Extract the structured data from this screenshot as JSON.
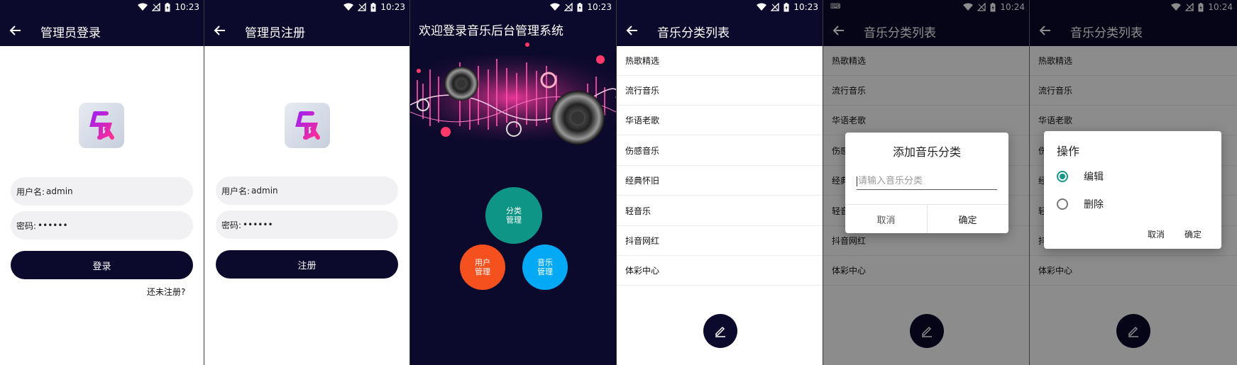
{
  "status": {
    "time_1": "10:23",
    "time_2": "10:23",
    "time_3": "10:23",
    "time_4": "10:23",
    "time_5": "10:24",
    "time_6": "10:24",
    "battery_icon": "battery-charging-icon",
    "wifi_icon": "wifi-icon",
    "signal_icon": "no-signal-icon"
  },
  "login": {
    "title": "管理员登录",
    "username_label": "用户名:",
    "username_value": "admin",
    "password_label": "密码:",
    "password_value": "••••••",
    "login_button": "登录",
    "register_link": "还未注册?"
  },
  "register": {
    "title": "管理员注册",
    "username_label": "用户名:",
    "username_value": "admin",
    "password_label": "密码:",
    "password_value": "••••••",
    "register_button": "注册"
  },
  "home": {
    "title": "欢迎登录音乐后台管理系统",
    "category_manage": "分类\n管理",
    "user_manage": "用户\n管理",
    "music_manage": "音乐\n管理"
  },
  "categories": {
    "title": "音乐分类列表",
    "items": [
      "热歌精选",
      "流行音乐",
      "华语老歌",
      "伤感音乐",
      "经典怀旧",
      "轻音乐",
      "抖音网红",
      "体彩中心"
    ]
  },
  "add_dialog": {
    "title": "添加音乐分类",
    "placeholder": "请输入音乐分类",
    "cancel": "取消",
    "confirm": "确定"
  },
  "op_dialog": {
    "title": "操作",
    "option_edit": "编辑",
    "option_delete": "删除",
    "cancel": "取消",
    "confirm": "确定"
  },
  "colors": {
    "primary": "#0c0a2c",
    "teal": "#0e9585",
    "orange": "#f4511e",
    "blue": "#03a9f4",
    "radio": "#14988a"
  }
}
